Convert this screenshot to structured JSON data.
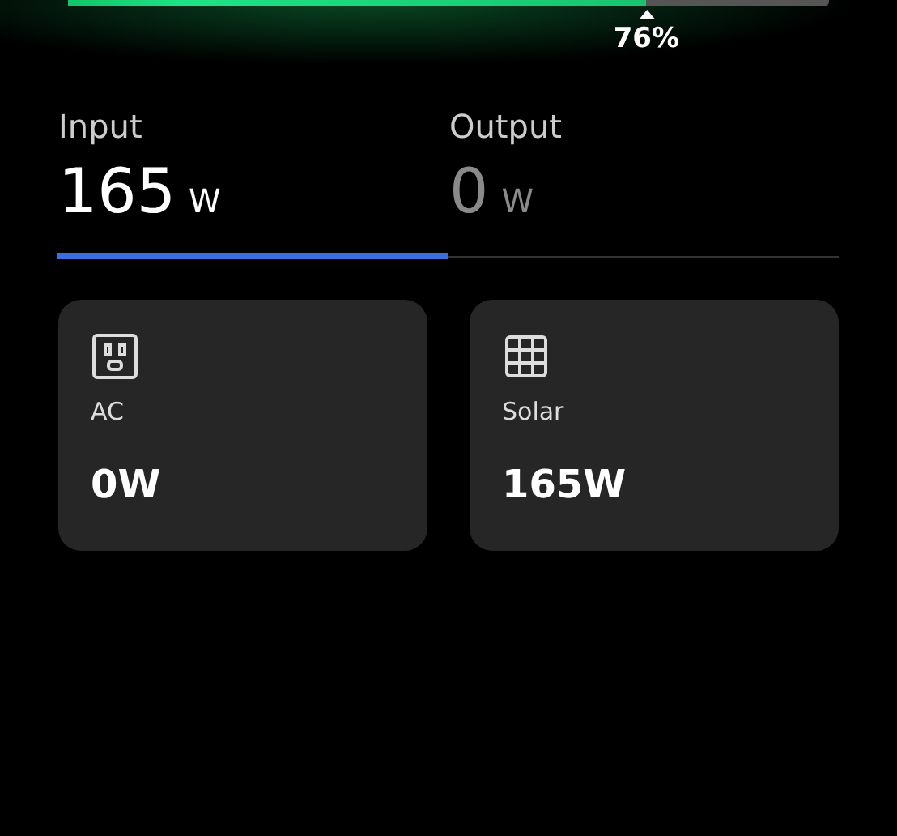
{
  "battery": {
    "level": 0.76,
    "reading": "76%"
  },
  "tabs": [
    {
      "label": "Input",
      "value": "165",
      "unit": "W",
      "selected": true
    },
    {
      "label": "Output",
      "value": "0",
      "unit": "W",
      "selected": false
    }
  ],
  "sources": [
    {
      "kind": "ac",
      "label": "AC",
      "reading": "0W"
    },
    {
      "kind": "solar",
      "label": "Solar",
      "reading": "165W"
    }
  ]
}
